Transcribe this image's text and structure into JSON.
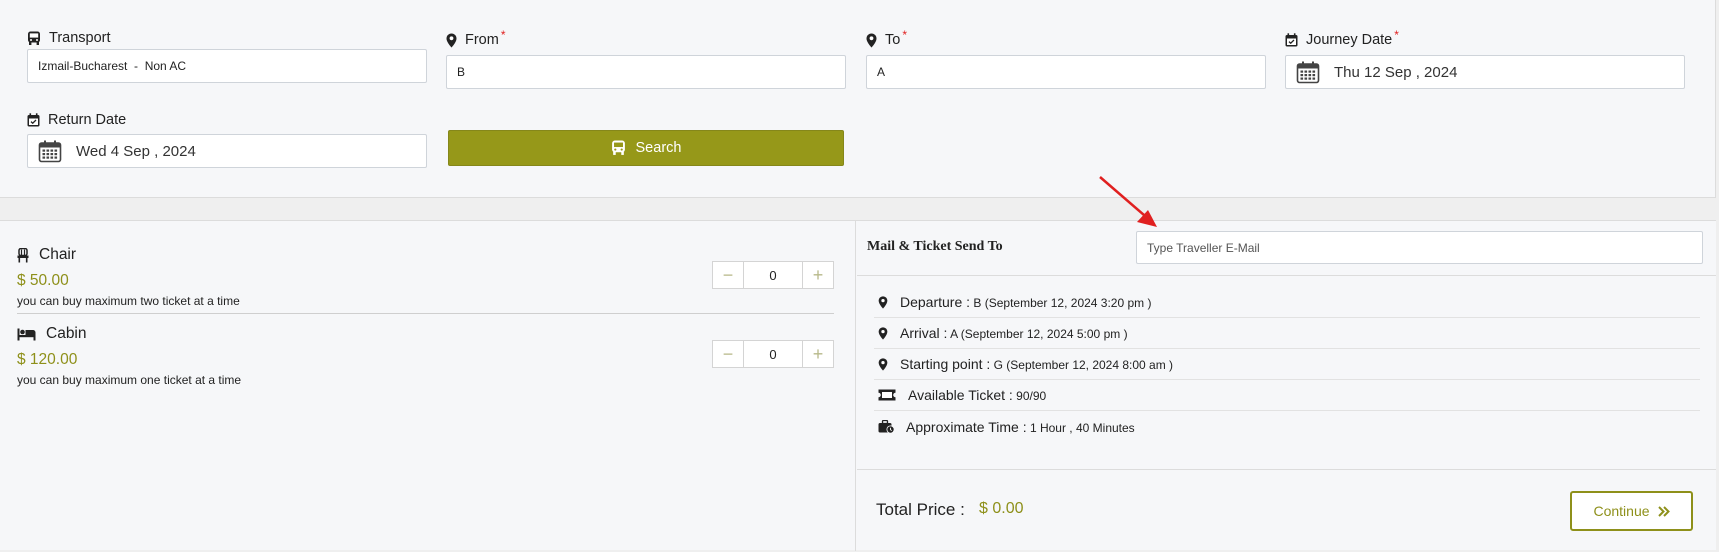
{
  "search": {
    "transport": {
      "label": "Transport",
      "value": "Izmail-Bucharest  -  Non AC"
    },
    "from": {
      "label": "From",
      "required_mark": "*",
      "value": "B"
    },
    "to": {
      "label": "To",
      "required_mark": "*",
      "value": "A"
    },
    "journey_date": {
      "label": "Journey Date",
      "required_mark": "*",
      "value": "Thu 12 Sep , 2024"
    },
    "return_date": {
      "label": "Return Date",
      "value": "Wed 4 Sep , 2024"
    },
    "search_button": "Search"
  },
  "seats": [
    {
      "name": "Chair",
      "icon": "chair-icon",
      "price": "$ 50.00",
      "note": "you can buy maximum two ticket at a time",
      "quantity": "0"
    },
    {
      "name": "Cabin",
      "icon": "bed-icon",
      "price": "$ 120.00",
      "note": "you can buy maximum one ticket at a time",
      "quantity": "0"
    }
  ],
  "stepper": {
    "minus": "−",
    "plus": "+"
  },
  "mail": {
    "label": "Mail & Ticket Send To",
    "placeholder": "Type Traveller E-Mail",
    "value": ""
  },
  "trip_info": {
    "departure": {
      "key": "Departure :",
      "value": "B (September 12, 2024 3:20 pm )"
    },
    "arrival": {
      "key": "Arrival :",
      "value": "A (September 12, 2024 5:00 pm )"
    },
    "starting_point": {
      "key": "Starting point :",
      "value": "G (September 12, 2024 8:00 am )"
    },
    "available_ticket": {
      "key": "Available Ticket :",
      "value": "90/90"
    },
    "approximate_time": {
      "key": "Approximate Time :",
      "value": "1 Hour , 40 Minutes"
    }
  },
  "total": {
    "label": "Total Price :",
    "value": "$ 0.00"
  },
  "continue_button": "Continue",
  "colors": {
    "accent": "#969819",
    "accent_text": "#8e901a",
    "required": "#e02020",
    "annotation_arrow": "#e02020"
  }
}
